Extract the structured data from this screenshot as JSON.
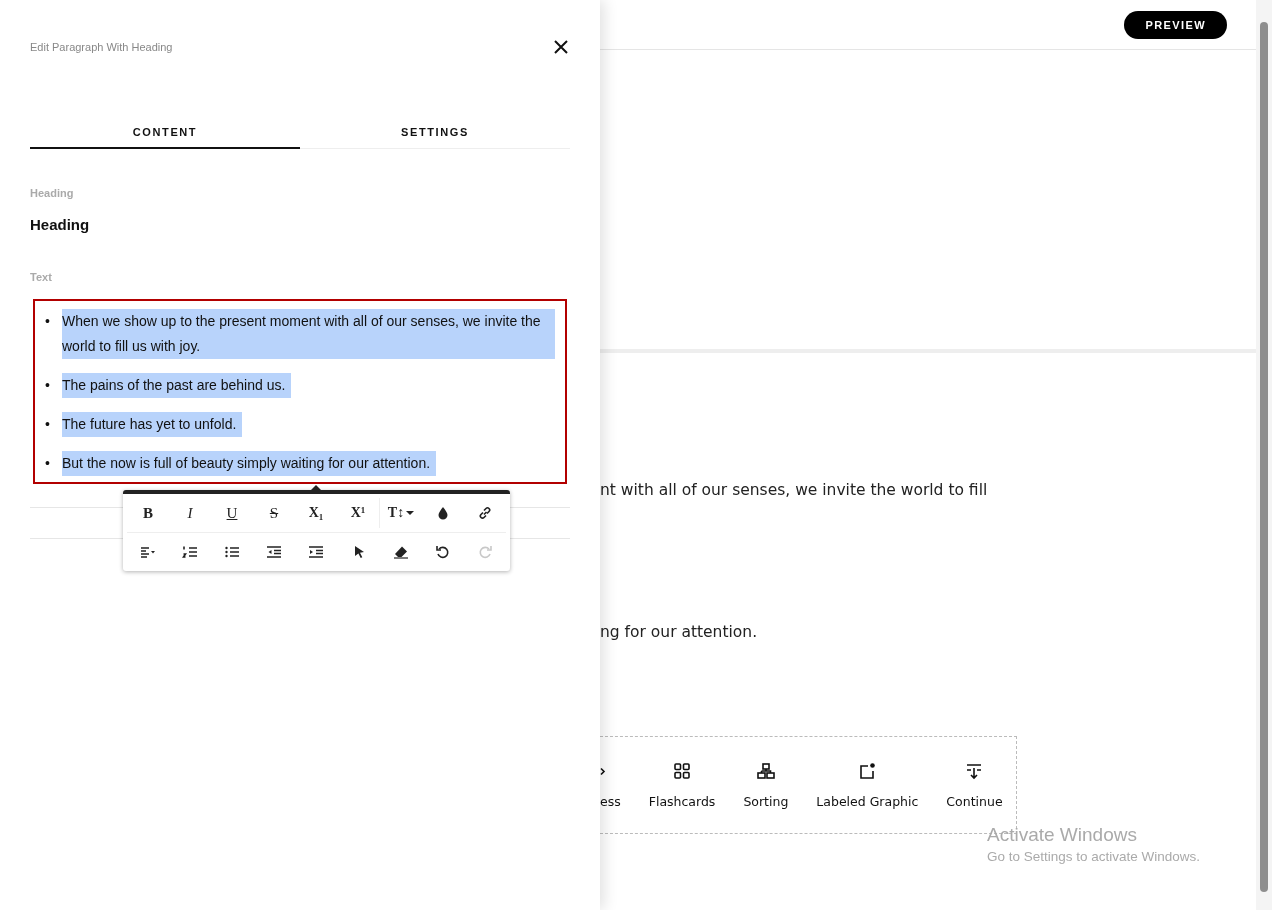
{
  "drawer": {
    "title": "Edit Paragraph With Heading",
    "tabs": [
      {
        "label": "CONTENT",
        "selected": true
      },
      {
        "label": "SETTINGS",
        "selected": false
      }
    ],
    "heading_label": "Heading",
    "heading_value": "Heading",
    "text_label": "Text",
    "bullets": [
      {
        "marker": "•",
        "text": "When we show up to the present moment with all of our senses, we invite the world to fill us with joy.",
        "selected": true
      },
      {
        "marker": "•",
        "text": "The pains of the past are behind us.",
        "selected": true
      },
      {
        "marker": "•",
        "text": "The future has yet to unfold.",
        "selected": true
      },
      {
        "marker": "•",
        "text": "But the now is full of beauty simply waiting for our attention.",
        "selected": true
      }
    ],
    "toolbar": [
      [
        {
          "kind": "bold",
          "label": "B",
          "disabled": false
        },
        {
          "kind": "italic",
          "label": "I",
          "disabled": false
        },
        {
          "kind": "underline",
          "label": "U",
          "disabled": false
        },
        {
          "kind": "strike",
          "label": "S",
          "disabled": false
        },
        {
          "kind": "sub",
          "label": "X₁",
          "disabled": false
        },
        {
          "kind": "sup",
          "label": "X¹",
          "disabled": false
        },
        {
          "kind": "size",
          "label": "T↕",
          "disabled": false
        },
        {
          "kind": "color",
          "disabled": false
        },
        {
          "kind": "link",
          "disabled": false
        }
      ],
      [
        {
          "kind": "align",
          "disabled": false
        },
        {
          "kind": "ol",
          "disabled": false
        },
        {
          "kind": "ul",
          "disabled": false
        },
        {
          "kind": "outdent",
          "disabled": false
        },
        {
          "kind": "indent",
          "disabled": false
        },
        {
          "kind": "pointer",
          "disabled": false
        },
        {
          "kind": "eraser",
          "disabled": false
        },
        {
          "kind": "undo",
          "disabled": false
        },
        {
          "kind": "redo",
          "disabled": true
        }
      ]
    ]
  },
  "page": {
    "preview_button": "PREVIEW",
    "paragraph_lines": [
      "nt with all of our senses, we invite the world to fill",
      "ng for our attention."
    ],
    "blocks": [
      {
        "kind": "arrow",
        "label": "ess"
      },
      {
        "kind": "grid",
        "label": "Flashcards"
      },
      {
        "kind": "sorting",
        "label": "Sorting"
      },
      {
        "kind": "labeled",
        "label": "Labeled Graphic"
      },
      {
        "kind": "continue",
        "label": "Continue"
      }
    ]
  },
  "os_notice": {
    "title": "Activate Windows",
    "subtitle": "Go to Settings to activate Windows."
  }
}
